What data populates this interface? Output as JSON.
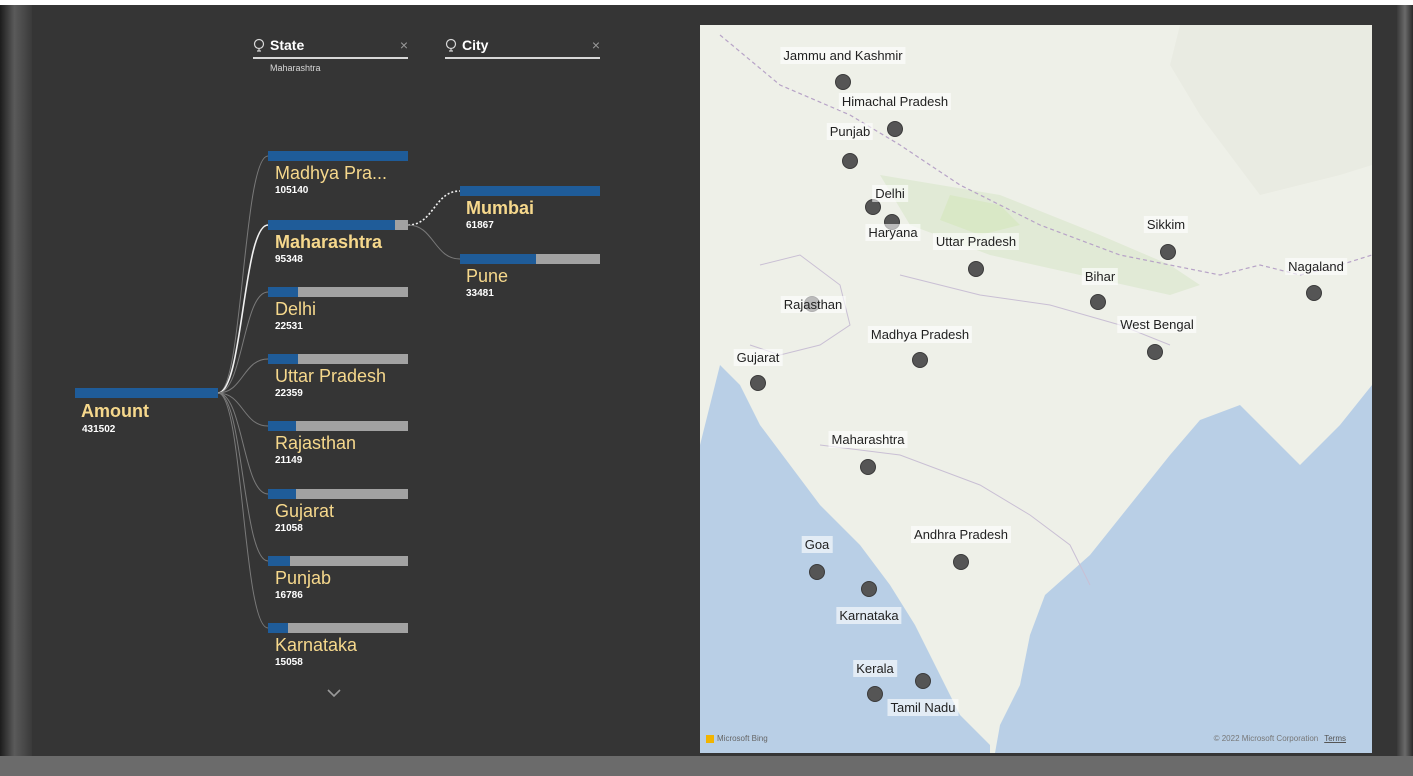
{
  "levels": [
    {
      "label": "State",
      "selected": "Maharashtra",
      "close": "×"
    },
    {
      "label": "City",
      "selected": "",
      "close": "×"
    }
  ],
  "root": {
    "name": "Amount",
    "value": "431502",
    "fraction": 1.0
  },
  "states": [
    {
      "name": "Madhya Pra...",
      "value": "105140",
      "fraction": 1.0,
      "selected": false
    },
    {
      "name": "Maharashtra",
      "value": "95348",
      "fraction": 0.905,
      "selected": true
    },
    {
      "name": "Delhi",
      "value": "22531",
      "fraction": 0.214,
      "selected": false
    },
    {
      "name": "Uttar Pradesh",
      "value": "22359",
      "fraction": 0.213,
      "selected": false
    },
    {
      "name": "Rajasthan",
      "value": "21149",
      "fraction": 0.201,
      "selected": false
    },
    {
      "name": "Gujarat",
      "value": "21058",
      "fraction": 0.2,
      "selected": false
    },
    {
      "name": "Punjab",
      "value": "16786",
      "fraction": 0.16,
      "selected": false
    },
    {
      "name": "Karnataka",
      "value": "15058",
      "fraction": 0.143,
      "selected": false
    }
  ],
  "cities": [
    {
      "name": "Mumbai",
      "value": "61867",
      "fraction": 1.0,
      "selected": true
    },
    {
      "name": "Pune",
      "value": "33481",
      "fraction": 0.541,
      "selected": false
    }
  ],
  "more_icon": "chevron-down-icon",
  "map": {
    "attribution": "Microsoft Bing",
    "copyright": "© 2022 Microsoft Corporation",
    "terms": "Terms",
    "locations": [
      {
        "name": "Jammu and Kashmir"
      },
      {
        "name": "Himachal Pradesh"
      },
      {
        "name": "Punjab"
      },
      {
        "name": "Delhi"
      },
      {
        "name": "Haryana"
      },
      {
        "name": "Uttar Pradesh"
      },
      {
        "name": "Sikkim"
      },
      {
        "name": "Nagaland"
      },
      {
        "name": "Bihar"
      },
      {
        "name": "Rajasthan"
      },
      {
        "name": "West Bengal"
      },
      {
        "name": "Madhya Pradesh"
      },
      {
        "name": "Gujarat"
      },
      {
        "name": "Maharashtra"
      },
      {
        "name": "Goa"
      },
      {
        "name": "Andhra Pradesh"
      },
      {
        "name": "Karnataka"
      },
      {
        "name": "Kerala"
      },
      {
        "name": "Tamil Nadu"
      }
    ]
  },
  "colors": {
    "bar_fill": "#1f5c99",
    "bar_track": "#a2a2a2",
    "label": "#f6d88c",
    "background": "#353535"
  }
}
